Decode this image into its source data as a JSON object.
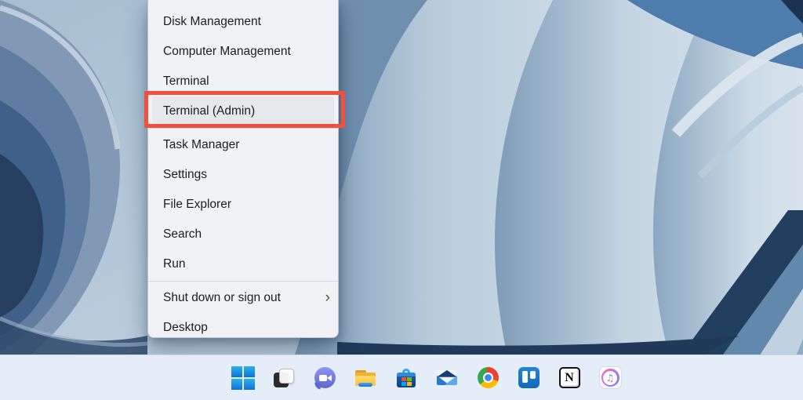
{
  "context_menu": {
    "items": [
      {
        "label": "Disk Management"
      },
      {
        "label": "Computer Management"
      },
      {
        "label": "Terminal"
      },
      {
        "label": "Terminal (Admin)",
        "highlighted": true,
        "separator_after": true
      },
      {
        "label": "Task Manager"
      },
      {
        "label": "Settings"
      },
      {
        "label": "File Explorer"
      },
      {
        "label": "Search"
      },
      {
        "label": "Run",
        "separator_after": true
      },
      {
        "label": "Shut down or sign out",
        "has_submenu": true,
        "chevron": "›"
      },
      {
        "label": "Desktop"
      }
    ]
  },
  "annotation": {
    "type": "highlight-rectangle",
    "target": "Terminal (Admin)",
    "color": "#f2503f"
  },
  "taskbar": {
    "icons": [
      {
        "name": "start"
      },
      {
        "name": "task-view"
      },
      {
        "name": "chat"
      },
      {
        "name": "file-explorer"
      },
      {
        "name": "microsoft-store"
      },
      {
        "name": "mail"
      },
      {
        "name": "chrome"
      },
      {
        "name": "trello"
      },
      {
        "name": "notion",
        "glyph": "N"
      },
      {
        "name": "itunes",
        "glyph": "♫"
      }
    ]
  },
  "wallpaper": {
    "name": "windows-11-bloom",
    "colors": {
      "light": "#cfdde8",
      "mid": "#7e9cb8",
      "dark": "#223a5a"
    }
  }
}
